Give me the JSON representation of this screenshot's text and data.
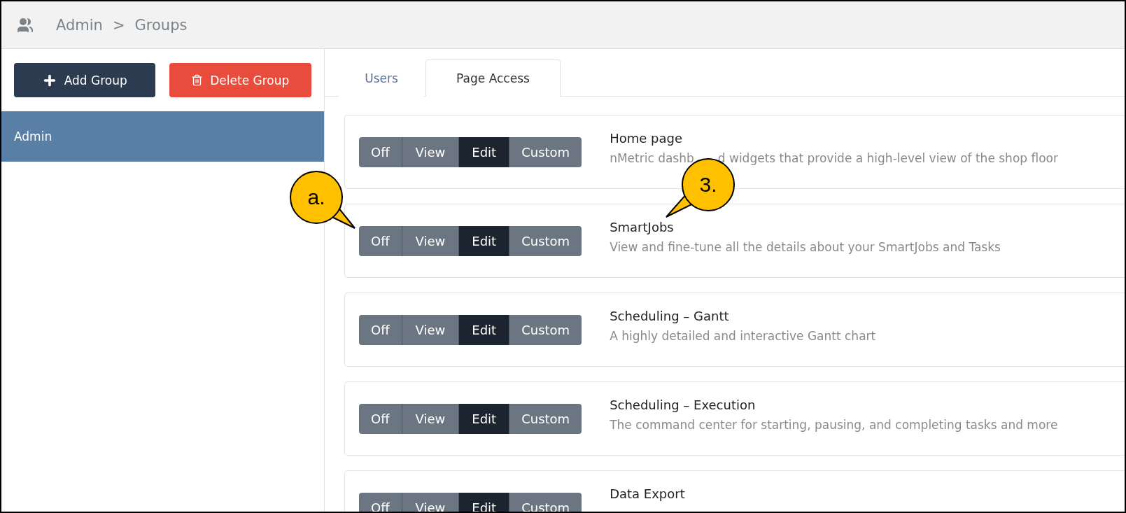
{
  "breadcrumb": {
    "items": [
      "Admin",
      "Groups"
    ],
    "separator": ">"
  },
  "sidebar": {
    "buttons": [
      {
        "kind": "add",
        "label": "Add Group"
      },
      {
        "kind": "delete",
        "label": "Delete Group"
      }
    ],
    "groups": [
      {
        "label": "Admin",
        "selected": true
      }
    ]
  },
  "tabs": [
    {
      "label": "Users",
      "selected": false
    },
    {
      "label": "Page Access",
      "selected": true
    }
  ],
  "pages": [
    {
      "title": "Home page",
      "description": [
        "nMetric dashb",
        "d widgets that provide a high-level view of the shop floor"
      ],
      "options": [
        {
          "label": "Off",
          "selected": false
        },
        {
          "label": "View",
          "selected": false
        },
        {
          "label": "Edit",
          "selected": true
        },
        {
          "label": "Custom",
          "selected": false
        }
      ]
    },
    {
      "title": "SmartJobs",
      "description": [
        "View and fine-tune all the details about your SmartJobs and Tasks"
      ],
      "options": [
        {
          "label": "Off",
          "selected": false
        },
        {
          "label": "View",
          "selected": false
        },
        {
          "label": "Edit",
          "selected": true
        },
        {
          "label": "Custom",
          "selected": false
        }
      ]
    },
    {
      "title": "Scheduling – Gantt",
      "description": [
        "A highly detailed and interactive Gantt chart"
      ],
      "options": [
        {
          "label": "Off",
          "selected": false
        },
        {
          "label": "View",
          "selected": false
        },
        {
          "label": "Edit",
          "selected": true
        },
        {
          "label": "Custom",
          "selected": false
        }
      ]
    },
    {
      "title": "Scheduling – Execution",
      "description": [
        "The command center for starting, pausing, and completing tasks and more"
      ],
      "options": [
        {
          "label": "Off",
          "selected": false
        },
        {
          "label": "View",
          "selected": false
        },
        {
          "label": "Edit",
          "selected": true
        },
        {
          "label": "Custom",
          "selected": false
        }
      ]
    },
    {
      "title": "Data Export",
      "options": [
        {
          "label": "Off",
          "selected": false
        },
        {
          "label": "View",
          "selected": false
        },
        {
          "label": "Edit",
          "selected": true
        },
        {
          "label": "Custom",
          "selected": false
        }
      ]
    }
  ],
  "callouts": [
    {
      "label": "a."
    },
    {
      "label": "3."
    }
  ]
}
